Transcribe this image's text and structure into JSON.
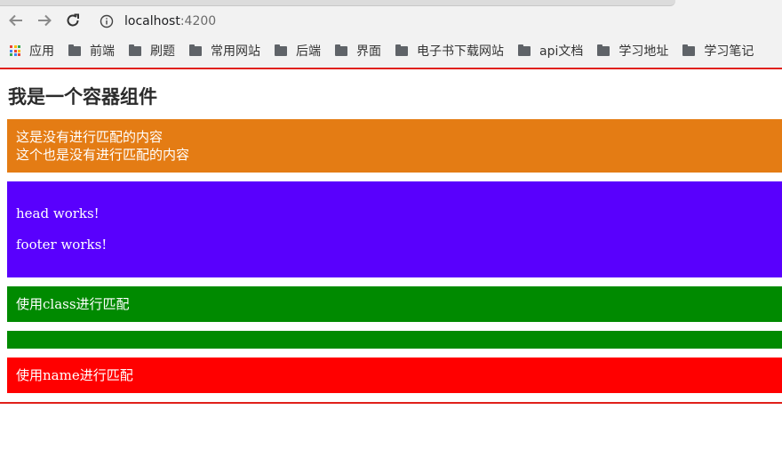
{
  "browser": {
    "url_host": "localhost",
    "url_port": ":4200",
    "bookmarks": [
      {
        "label": "应用",
        "icon": "apps-grid-icon"
      },
      {
        "label": "前端",
        "icon": "folder-icon"
      },
      {
        "label": "刷题",
        "icon": "folder-icon"
      },
      {
        "label": "常用网站",
        "icon": "folder-icon"
      },
      {
        "label": "后端",
        "icon": "folder-icon"
      },
      {
        "label": "界面",
        "icon": "folder-icon"
      },
      {
        "label": "电子书下载网站",
        "icon": "folder-icon"
      },
      {
        "label": "api文档",
        "icon": "folder-icon"
      },
      {
        "label": "学习地址",
        "icon": "folder-icon"
      },
      {
        "label": "学习笔记",
        "icon": "folder-icon"
      }
    ]
  },
  "page": {
    "title": "我是一个容器组件",
    "unmatched": {
      "line1": "这是没有进行匹配的内容",
      "line2": "这个也是没有进行匹配的内容"
    },
    "slots": {
      "head": "head works!",
      "footer": "footer works!"
    },
    "class_match": "使用class进行匹配",
    "name_match": "使用name进行匹配"
  },
  "colors": {
    "frame_border": "#e0201a",
    "unmatched_bg": "#e47c14",
    "slot_bg": "#5900fd",
    "class_bg": "#008a00",
    "name_bg": "#ff0000"
  }
}
